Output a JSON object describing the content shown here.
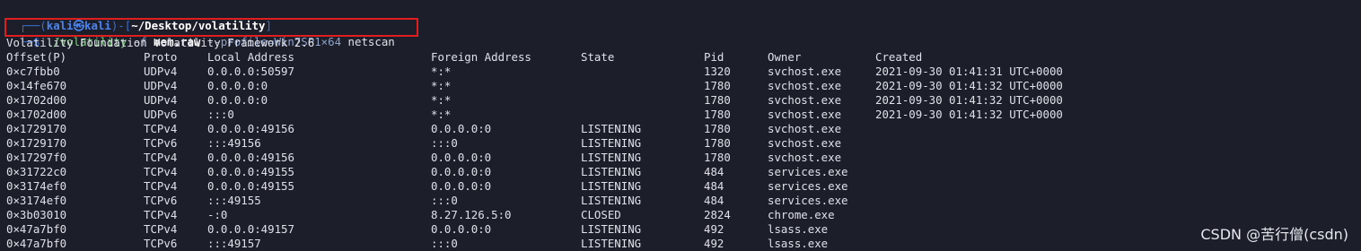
{
  "prompt": {
    "frame_left": "┌──(",
    "user_host": "kali㉿kali",
    "frame_mid": ")-[",
    "path": "~/Desktop/volatility",
    "frame_right": "]",
    "arrow": "└─$",
    "command": "./volatility",
    "flag_f": "-f",
    "file": "mem.raw",
    "profile": "--profile=Win7SP1×64",
    "plugin": "netscan"
  },
  "banner": "Volatility Foundation Volatility Framework 2.6",
  "table": {
    "headers": [
      "Offset(P)",
      "Proto",
      "Local Address",
      "Foreign Address",
      "State",
      "Pid",
      "Owner",
      "Created"
    ],
    "rows": [
      [
        "0×c7fbb0",
        "UDPv4",
        "0.0.0.0:50597",
        "*:*",
        "",
        "1320",
        "svchost.exe",
        "2021-09-30 01:41:31 UTC+0000"
      ],
      [
        "0×14fe670",
        "UDPv4",
        "0.0.0.0:0",
        "*:*",
        "",
        "1780",
        "svchost.exe",
        "2021-09-30 01:41:32 UTC+0000"
      ],
      [
        "0×1702d00",
        "UDPv4",
        "0.0.0.0:0",
        "*:*",
        "",
        "1780",
        "svchost.exe",
        "2021-09-30 01:41:32 UTC+0000"
      ],
      [
        "0×1702d00",
        "UDPv6",
        ":::0",
        "*:*",
        "",
        "1780",
        "svchost.exe",
        "2021-09-30 01:41:32 UTC+0000"
      ],
      [
        "0×1729170",
        "TCPv4",
        "0.0.0.0:49156",
        "0.0.0.0:0",
        "LISTENING",
        "1780",
        "svchost.exe",
        ""
      ],
      [
        "0×1729170",
        "TCPv6",
        ":::49156",
        ":::0",
        "LISTENING",
        "1780",
        "svchost.exe",
        ""
      ],
      [
        "0×17297f0",
        "TCPv4",
        "0.0.0.0:49156",
        "0.0.0.0:0",
        "LISTENING",
        "1780",
        "svchost.exe",
        ""
      ],
      [
        "0×31722c0",
        "TCPv4",
        "0.0.0.0:49155",
        "0.0.0.0:0",
        "LISTENING",
        "484",
        "services.exe",
        ""
      ],
      [
        "0×3174ef0",
        "TCPv4",
        "0.0.0.0:49155",
        "0.0.0.0:0",
        "LISTENING",
        "484",
        "services.exe",
        ""
      ],
      [
        "0×3174ef0",
        "TCPv6",
        ":::49155",
        ":::0",
        "LISTENING",
        "484",
        "services.exe",
        ""
      ],
      [
        "0×3b03010",
        "TCPv4",
        "-:0",
        "8.27.126.5:0",
        "CLOSED",
        "2824",
        "chrome.exe",
        ""
      ],
      [
        "0×47a7bf0",
        "TCPv4",
        "0.0.0.0:49157",
        "0.0.0.0:0",
        "LISTENING",
        "492",
        "lsass.exe",
        ""
      ],
      [
        "0×47a7bf0",
        "TCPv6",
        ":::49157",
        ":::0",
        "LISTENING",
        "492",
        "lsass.exe",
        ""
      ]
    ]
  },
  "watermark": "CSDN @苦行僧(csdn)",
  "colors": {
    "background": "#1c1e2a",
    "prompt_frame": "#3b6fd4",
    "highlight_box": "#e01e1e"
  }
}
